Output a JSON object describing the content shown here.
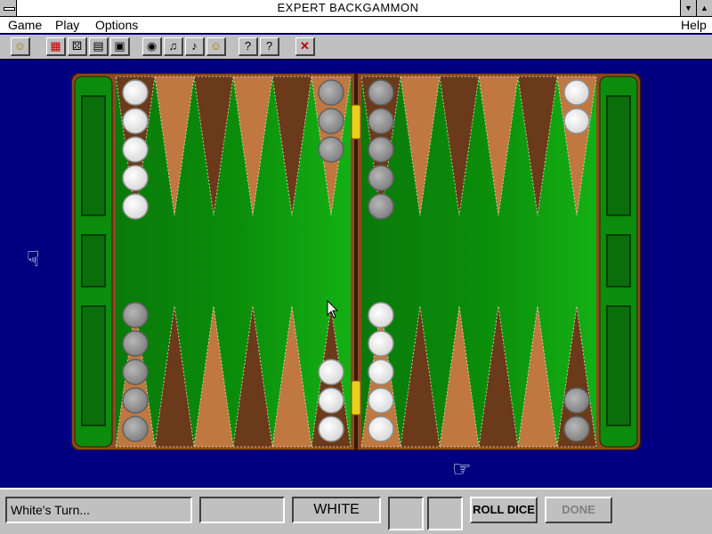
{
  "window": {
    "title": "EXPERT BACKGAMMON"
  },
  "menu": {
    "game": "Game",
    "play": "Play",
    "options": "Options",
    "help": "Help"
  },
  "toolbar": {
    "buttons": [
      {
        "name": "smiley-icon",
        "glyph": "☺"
      },
      {
        "name": "board-pattern-icon",
        "glyph": "▦"
      },
      {
        "name": "dice-icon",
        "glyph": "⚄"
      },
      {
        "name": "cards-icon",
        "glyph": "▤"
      },
      {
        "name": "photo-icon",
        "glyph": "▣"
      },
      {
        "name": "eye-icon",
        "glyph": "◉"
      },
      {
        "name": "speaker-icon",
        "glyph": "♫"
      },
      {
        "name": "music-note-icon",
        "glyph": "♪"
      },
      {
        "name": "coin-icon",
        "glyph": "☺"
      },
      {
        "name": "help-icon",
        "glyph": "?"
      },
      {
        "name": "context-help-icon",
        "glyph": "?"
      },
      {
        "name": "close-icon",
        "glyph": "✕"
      }
    ]
  },
  "board": {
    "colors": {
      "frame": "#8b4a22",
      "felt": "#008000",
      "felt_light": "#14b014",
      "point_light": "#c07840",
      "point_dark": "#6b3a1a",
      "white_checker": "#ffffff",
      "gray_checker": "#a0a0a0"
    },
    "checkers": {
      "left_top": [
        {
          "col": 0,
          "color": "white",
          "count": 5
        },
        {
          "col": 5,
          "color": "gray",
          "count": 3
        }
      ],
      "left_bottom": [
        {
          "col": 0,
          "color": "gray",
          "count": 5
        },
        {
          "col": 5,
          "color": "white",
          "count": 3
        }
      ],
      "right_top": [
        {
          "col": 0,
          "color": "gray",
          "count": 5
        },
        {
          "col": 5,
          "color": "white",
          "count": 2
        }
      ],
      "right_bottom": [
        {
          "col": 0,
          "color": "white",
          "count": 5
        },
        {
          "col": 5,
          "color": "gray",
          "count": 2
        }
      ]
    }
  },
  "status": {
    "message": "White's Turn...",
    "secondary": "",
    "player": "WHITE",
    "die1": "",
    "die2": "",
    "roll_label": "ROLL DICE",
    "done_label": "DONE"
  }
}
